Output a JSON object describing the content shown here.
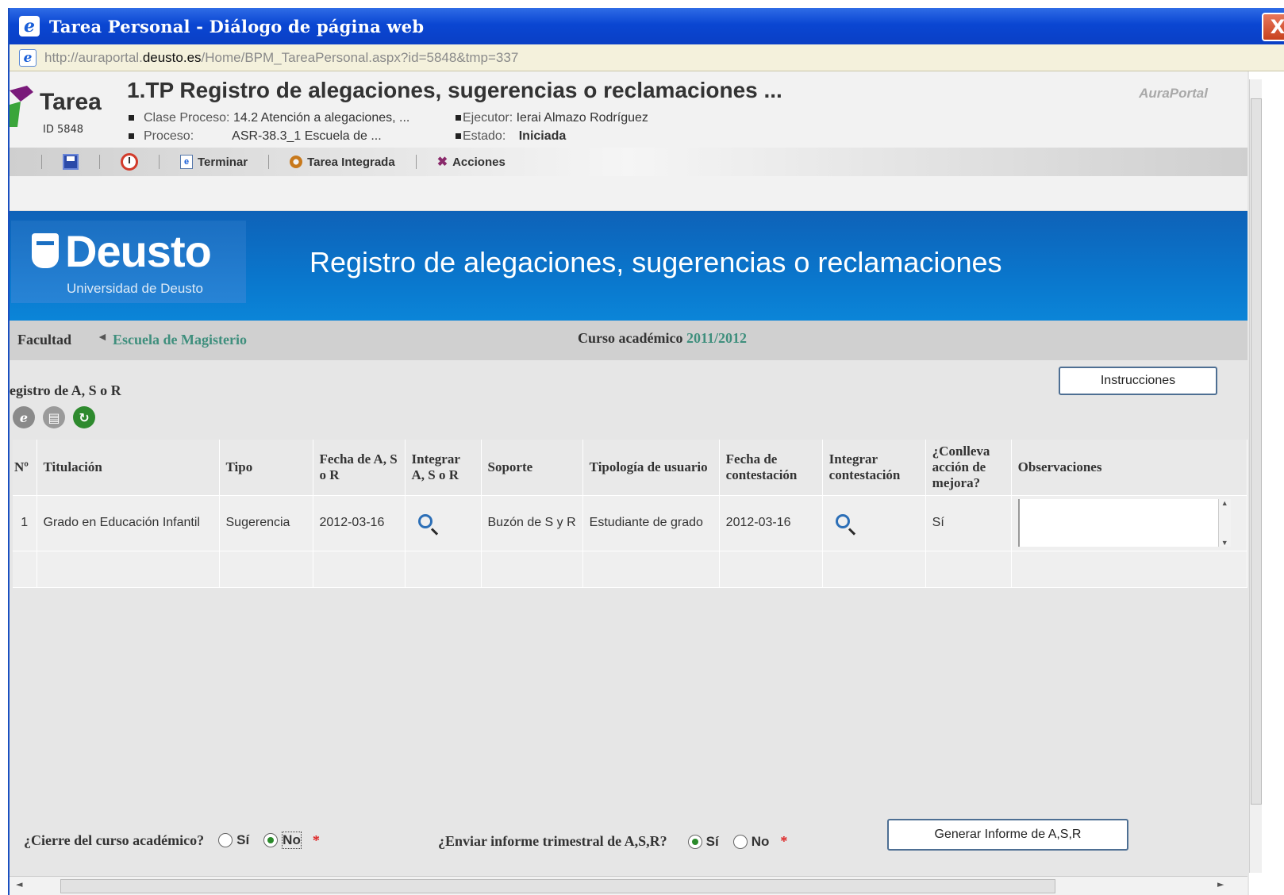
{
  "window": {
    "title": "Tarea Personal - Diálogo de página web",
    "close_label": "X"
  },
  "address": {
    "url_prefix": "http://auraportal.",
    "url_domain": "deusto.es",
    "url_path": "/Home/BPM_TareaPersonal.aspx?id=5848&tmp=337"
  },
  "task": {
    "label": "Tarea",
    "id": "ID 5848",
    "title": "1.TP Registro de alegaciones, sugerencias o reclamaciones ...",
    "clase_key": "Clase Proceso:",
    "clase_value": "14.2 Atención a alegaciones, ...",
    "proceso_key": "Proceso:",
    "proceso_value": "ASR-38.3_1 Escuela de ...",
    "ejecutor_key": "Ejecutor:",
    "ejecutor_value": "Ierai Almazo Rodríguez",
    "estado_key": "Estado:",
    "estado_value": "Iniciada",
    "brand": "AuraPortal"
  },
  "toolbar": {
    "terminar": "Terminar",
    "tarea_integrada": "Tarea Integrada",
    "acciones": "Acciones"
  },
  "banner": {
    "brand_name": "Deusto",
    "brand_sub": "Universidad de Deusto",
    "title": "Registro de alegaciones, sugerencias o reclamaciones"
  },
  "facultad": {
    "label": "Facultad",
    "value": "Escuela de Magisterio",
    "curso_label": "Curso académico",
    "curso_value": "2011/2012"
  },
  "section": {
    "title": "egistro de A, S o R",
    "instrucciones": "Instrucciones"
  },
  "table": {
    "headers": [
      "Nº",
      "Titulación",
      "Tipo",
      "Fecha de A, S o R",
      "Integrar A, S o R",
      "Soporte",
      "Tipología de usuario",
      "Fecha de contestación",
      "Integrar contestación",
      "¿Conlleva acción de mejora?",
      "Observaciones"
    ],
    "rows": [
      {
        "num": "1",
        "titulacion": "Grado en Educación Infantil",
        "tipo": "Sugerencia",
        "fecha": "2012-03-16",
        "soporte": "Buzón de S y R",
        "tipologia": "Estudiante de grado",
        "fecha_contestacion": "2012-03-16",
        "conlleva": "Sí",
        "observaciones": ""
      }
    ]
  },
  "bottom": {
    "cierre_question": "¿Cierre del curso académico?",
    "cierre_si": "Sí",
    "cierre_no": "No",
    "cierre_selected": "No",
    "informe_question": "¿Enviar informe trimestral de A,S,R?",
    "informe_si": "Sí",
    "informe_no": "No",
    "informe_selected": "Sí",
    "required_mark": "*",
    "generar_button": "Generar Informe de A,S,R"
  }
}
